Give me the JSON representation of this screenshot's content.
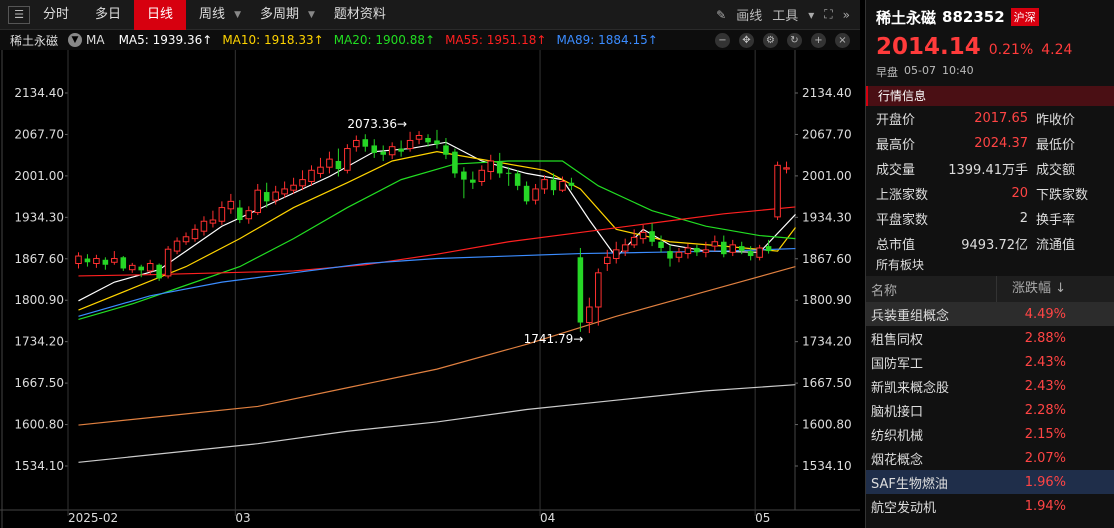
{
  "toolbar": {
    "tabs": [
      "分时",
      "多日",
      "日线",
      "周线",
      "多周期",
      "题材资料"
    ],
    "active_tab": "日线",
    "draw_label": "画线",
    "tools_label": "工具"
  },
  "mabar": {
    "name": "稀土永磁",
    "ma_label": "MA",
    "values": [
      {
        "label": "MA5: 1939.36↑",
        "color": "#ffffff"
      },
      {
        "label": "MA10: 1918.33↑",
        "color": "#ffd400"
      },
      {
        "label": "MA20: 1900.88↑",
        "color": "#22dd22"
      },
      {
        "label": "MA55: 1951.18↑",
        "color": "#ff2020"
      },
      {
        "label": "MA89: 1884.15↑",
        "color": "#3b8cff"
      }
    ]
  },
  "chart_data": {
    "type": "candlestick",
    "y_ticks": [
      "2134.40",
      "2067.70",
      "2001.00",
      "1934.30",
      "1867.60",
      "1800.90",
      "1734.20",
      "1667.50",
      "1600.80",
      "1534.10"
    ],
    "x_labels": [
      "2025-02",
      "03",
      "04",
      "05"
    ],
    "annotations": [
      {
        "text": "2073.36",
        "value": 2073.36
      },
      {
        "text": "1741.79",
        "value": 1741.79
      }
    ],
    "candles": [
      [
        1860,
        1872,
        1878,
        1852
      ],
      [
        1868,
        1862,
        1875,
        1855
      ],
      [
        1860,
        1868,
        1874,
        1853
      ],
      [
        1866,
        1858,
        1870,
        1850
      ],
      [
        1862,
        1868,
        1880,
        1858
      ],
      [
        1870,
        1852,
        1872,
        1848
      ],
      [
        1850,
        1857,
        1861,
        1845
      ],
      [
        1855,
        1849,
        1858,
        1838
      ],
      [
        1848,
        1860,
        1866,
        1842
      ],
      [
        1858,
        1836,
        1860,
        1832
      ],
      [
        1840,
        1883,
        1888,
        1836
      ],
      [
        1880,
        1896,
        1902,
        1875
      ],
      [
        1895,
        1903,
        1910,
        1890
      ],
      [
        1900,
        1915,
        1923,
        1895
      ],
      [
        1912,
        1928,
        1936,
        1905
      ],
      [
        1925,
        1930,
        1945,
        1918
      ],
      [
        1928,
        1950,
        1960,
        1922
      ],
      [
        1948,
        1960,
        1972,
        1940
      ],
      [
        1950,
        1930,
        1962,
        1925
      ],
      [
        1932,
        1945,
        1952,
        1924
      ],
      [
        1942,
        1978,
        1988,
        1938
      ],
      [
        1975,
        1960,
        1990,
        1950
      ],
      [
        1962,
        1975,
        1985,
        1955
      ],
      [
        1972,
        1980,
        1992,
        1966
      ],
      [
        1978,
        1986,
        1998,
        1972
      ],
      [
        1985,
        1995,
        2010,
        1978
      ],
      [
        1992,
        2010,
        2018,
        1985
      ],
      [
        2005,
        2015,
        2030,
        1998
      ],
      [
        2015,
        2028,
        2040,
        2005
      ],
      [
        2025,
        2012,
        2045,
        2000
      ],
      [
        2010,
        2045,
        2052,
        2005
      ],
      [
        2048,
        2058,
        2066,
        2040
      ],
      [
        2060,
        2048,
        2068,
        2040
      ],
      [
        2050,
        2038,
        2060,
        2030
      ],
      [
        2040,
        2035,
        2050,
        2025
      ],
      [
        2035,
        2048,
        2055,
        2028
      ],
      [
        2045,
        2040,
        2058,
        2032
      ],
      [
        2045,
        2058,
        2072,
        2040
      ],
      [
        2060,
        2066,
        2073,
        2052
      ],
      [
        2062,
        2055,
        2068,
        2048
      ],
      [
        2058,
        2052,
        2075,
        2045
      ],
      [
        2050,
        2035,
        2062,
        2028
      ],
      [
        2040,
        2005,
        2045,
        1998
      ],
      [
        2008,
        1995,
        2015,
        1965
      ],
      [
        1995,
        1990,
        2008,
        1980
      ],
      [
        1992,
        2010,
        2018,
        1985
      ],
      [
        2008,
        2025,
        2035,
        1995
      ],
      [
        2025,
        2005,
        2038,
        1998
      ],
      [
        2006,
        2005,
        2015,
        1985
      ],
      [
        2005,
        1985,
        2010,
        1978
      ],
      [
        1985,
        1960,
        1992,
        1955
      ],
      [
        1962,
        1980,
        1988,
        1955
      ],
      [
        1980,
        1995,
        2002,
        1972
      ],
      [
        1995,
        1978,
        2005,
        1970
      ],
      [
        1978,
        1992,
        2000,
        1975
      ],
      [
        1990,
        1985,
        1998,
        1978
      ],
      [
        1870,
        1765,
        1885,
        1750
      ],
      [
        1765,
        1790,
        1805,
        1748
      ],
      [
        1790,
        1845,
        1852,
        1760
      ],
      [
        1860,
        1870,
        1882,
        1848
      ],
      [
        1868,
        1882,
        1895,
        1860
      ],
      [
        1880,
        1890,
        1900,
        1872
      ],
      [
        1890,
        1902,
        1915,
        1885
      ],
      [
        1900,
        1910,
        1922,
        1892
      ],
      [
        1912,
        1895,
        1925,
        1888
      ],
      [
        1895,
        1885,
        1905,
        1878
      ],
      [
        1880,
        1868,
        1890,
        1855
      ],
      [
        1870,
        1878,
        1885,
        1862
      ],
      [
        1876,
        1885,
        1892,
        1868
      ],
      [
        1885,
        1878,
        1890,
        1872
      ],
      [
        1878,
        1882,
        1895,
        1870
      ],
      [
        1888,
        1895,
        1905,
        1880
      ],
      [
        1895,
        1875,
        1905,
        1870
      ],
      [
        1878,
        1890,
        1898,
        1872
      ],
      [
        1888,
        1880,
        1895,
        1875
      ],
      [
        1880,
        1872,
        1888,
        1865
      ],
      [
        1870,
        1885,
        1890,
        1865
      ],
      [
        1888,
        1880,
        1898,
        1876
      ],
      [
        1935,
        2018,
        2024,
        1930
      ],
      [
        2012,
        2014,
        2024,
        2005
      ]
    ],
    "ma_series": [
      {
        "name": "MA5",
        "color": "#ffffff",
        "pts": [
          [
            0,
            1800
          ],
          [
            4,
            1830
          ],
          [
            9,
            1850
          ],
          [
            12,
            1880
          ],
          [
            16,
            1920
          ],
          [
            22,
            1960
          ],
          [
            28,
            2000
          ],
          [
            33,
            2040
          ],
          [
            37,
            2045
          ],
          [
            41,
            2055
          ],
          [
            45,
            2025
          ],
          [
            50,
            2005
          ],
          [
            54,
            1995
          ],
          [
            57,
            1930
          ],
          [
            60,
            1870
          ],
          [
            63,
            1915
          ],
          [
            66,
            1890
          ],
          [
            70,
            1880
          ],
          [
            76,
            1878
          ],
          [
            80,
            1939
          ]
        ]
      },
      {
        "name": "MA10",
        "color": "#ffd400",
        "pts": [
          [
            0,
            1785
          ],
          [
            6,
            1820
          ],
          [
            12,
            1855
          ],
          [
            18,
            1900
          ],
          [
            24,
            1950
          ],
          [
            30,
            1990
          ],
          [
            35,
            2025
          ],
          [
            40,
            2040
          ],
          [
            46,
            2025
          ],
          [
            52,
            2010
          ],
          [
            56,
            1980
          ],
          [
            60,
            1915
          ],
          [
            66,
            1895
          ],
          [
            72,
            1888
          ],
          [
            78,
            1880
          ],
          [
            80,
            1918
          ]
        ]
      },
      {
        "name": "MA20",
        "color": "#22dd22",
        "pts": [
          [
            0,
            1770
          ],
          [
            6,
            1795
          ],
          [
            12,
            1825
          ],
          [
            18,
            1855
          ],
          [
            24,
            1900
          ],
          [
            30,
            1950
          ],
          [
            36,
            1995
          ],
          [
            42,
            2020
          ],
          [
            48,
            2025
          ],
          [
            54,
            2025
          ],
          [
            58,
            1985
          ],
          [
            64,
            1945
          ],
          [
            70,
            1920
          ],
          [
            76,
            1905
          ],
          [
            80,
            1900
          ]
        ]
      },
      {
        "name": "MA55",
        "color": "#ff2020",
        "pts": [
          [
            0,
            1840
          ],
          [
            8,
            1842
          ],
          [
            16,
            1845
          ],
          [
            24,
            1848
          ],
          [
            32,
            1858
          ],
          [
            40,
            1875
          ],
          [
            48,
            1895
          ],
          [
            56,
            1910
          ],
          [
            64,
            1925
          ],
          [
            72,
            1940
          ],
          [
            80,
            1951
          ]
        ]
      },
      {
        "name": "MA89",
        "color": "#3b8cff",
        "pts": [
          [
            0,
            1775
          ],
          [
            8,
            1808
          ],
          [
            16,
            1830
          ],
          [
            24,
            1845
          ],
          [
            32,
            1860
          ],
          [
            40,
            1868
          ],
          [
            48,
            1872
          ],
          [
            56,
            1876
          ],
          [
            64,
            1878
          ],
          [
            72,
            1880
          ],
          [
            80,
            1884
          ]
        ]
      },
      {
        "name": "MA120",
        "color": "#e08040",
        "pts": [
          [
            0,
            1600
          ],
          [
            10,
            1615
          ],
          [
            20,
            1630
          ],
          [
            30,
            1660
          ],
          [
            40,
            1690
          ],
          [
            50,
            1730
          ],
          [
            60,
            1775
          ],
          [
            70,
            1815
          ],
          [
            80,
            1855
          ]
        ]
      },
      {
        "name": "MA250",
        "color": "#cccccc",
        "pts": [
          [
            0,
            1540
          ],
          [
            10,
            1555
          ],
          [
            20,
            1570
          ],
          [
            30,
            1590
          ],
          [
            40,
            1605
          ],
          [
            50,
            1625
          ],
          [
            60,
            1640
          ],
          [
            70,
            1655
          ],
          [
            80,
            1665
          ]
        ]
      }
    ],
    "ylim": [
      1534.1,
      2134.4
    ]
  },
  "panel": {
    "name": "稀土永磁",
    "code": "882352",
    "market_tag": "沪深",
    "price": "2014.14",
    "pct": "0.21%",
    "change": "4.24",
    "session": "早盘",
    "date": "05-07",
    "time": "10:40",
    "section": "行情信息",
    "rows": [
      {
        "l": "开盘价",
        "v": "2017.65",
        "v_white": false,
        "l2": "昨收价"
      },
      {
        "l": "最高价",
        "v": "2024.37",
        "v_white": false,
        "l2": "最低价"
      },
      {
        "l": "成交量",
        "v": "1399.41万手",
        "v_white": true,
        "l2": "成交额"
      },
      {
        "l": "上涨家数",
        "v": "20",
        "v_white": false,
        "l2": "下跌家数"
      },
      {
        "l": "平盘家数",
        "v": "2",
        "v_white": true,
        "l2": "换手率"
      },
      {
        "l": "总市值",
        "v": "9493.72亿",
        "v_white": true,
        "l2": "流通值"
      }
    ],
    "boards_label": "所有板块",
    "table_head": {
      "name": "名称",
      "pct": "涨跌幅 ↓"
    },
    "boards": [
      {
        "n": "兵装重组概念",
        "p": "4.49%"
      },
      {
        "n": "租售同权",
        "p": "2.88%"
      },
      {
        "n": "国防军工",
        "p": "2.43%"
      },
      {
        "n": "新凯来概念股",
        "p": "2.43%"
      },
      {
        "n": "脑机接口",
        "p": "2.28%"
      },
      {
        "n": "纺织机械",
        "p": "2.15%"
      },
      {
        "n": "烟花概念",
        "p": "2.07%"
      },
      {
        "n": "SAF生物燃油",
        "p": "1.96%"
      },
      {
        "n": "航空发动机",
        "p": "1.94%"
      }
    ]
  }
}
